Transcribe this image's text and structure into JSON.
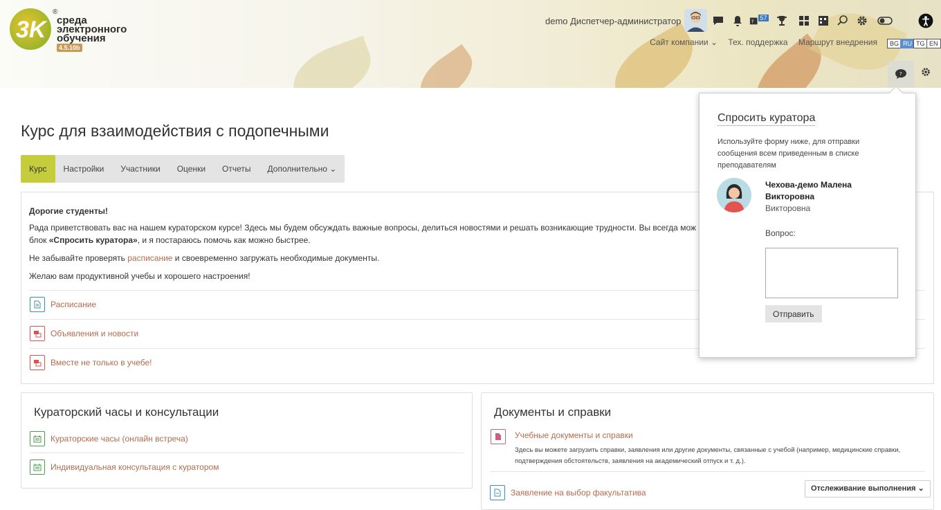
{
  "header": {
    "logo_lines": [
      "среда",
      "электронного",
      "обучения"
    ],
    "logo_reg": "®",
    "version": "4.5.10b",
    "user_name": "demo Диспетчер-администратор",
    "badge_count": "57",
    "nav_links": [
      "Сайт компании",
      "Тех. поддержка",
      "Маршрут внедрения"
    ],
    "languages": [
      {
        "code": "BG",
        "active": false
      },
      {
        "code": "RU",
        "active": true
      },
      {
        "code": "TG",
        "active": false
      },
      {
        "code": "EN",
        "active": false
      }
    ]
  },
  "course": {
    "title": "Курс для взаимодействия с подопечными",
    "tabs": [
      "Курс",
      "Настройки",
      "Участники",
      "Оценки",
      "Отчеты",
      "Дополнительно"
    ],
    "active_tab": "Курс"
  },
  "intro": {
    "greeting": "Дорогие студенты!",
    "p1_start": "Рада приветствовать вас на нашем кураторском курсе! Здесь мы будем обсуждать важные вопросы, делиться новостями и решать возникающие трудности. Вы всегда мож",
    "p1_line2_start": "блок ",
    "p1_bold": "«Спросить куратора»",
    "p1_line2_end": ", и я постараюсь помочь как можно быстрее.",
    "p2_start": "Не забывайте проверять ",
    "p2_link": "расписание",
    "p2_end": " и своевременно загружать необходимые документы.",
    "p3": "Желаю вам продуктивной учебы и хорошего настроения!"
  },
  "activities": [
    {
      "label": "Расписание",
      "icon": "document-icon"
    },
    {
      "label": "Объявления и новости",
      "icon": "forum-icon"
    },
    {
      "label": "Вместе не только в учебе!",
      "icon": "forum-icon"
    }
  ],
  "section_left": {
    "title": "Кураторский часы и консультации",
    "items": [
      "Кураторские часы (онлайн встреча)",
      "Индивидуальная консультация с куратором"
    ]
  },
  "section_right": {
    "title": "Документы и справки",
    "item1_label": "Учебные документы и справки",
    "item1_desc": "Здесь вы можете загрузить справки, заявления или другие документы, связанные с учебой (например, медицинские справки, подтверждения обстоятельств, заявления на академический отпуск и т. д.).",
    "item2_label": "Заявление на выбор факультатива",
    "track_label": "Отслеживание выполнения"
  },
  "popup": {
    "title": "Спросить куратора",
    "description": "Используйте форму ниже, для отправки сообщения всем приведенным в списке преподавателям",
    "curator_name": "Чехова-демо Малена Викторовна",
    "curator_sub": "Викторовна",
    "question_label": "Вопрос:",
    "send_label": "Отправить"
  },
  "colors": {
    "accent": "#c5ce3a",
    "link": "#b26c4e",
    "green_icon": "#4e9a4e",
    "red_icon": "#d9534f",
    "blue_icon": "#3f8fa8"
  }
}
